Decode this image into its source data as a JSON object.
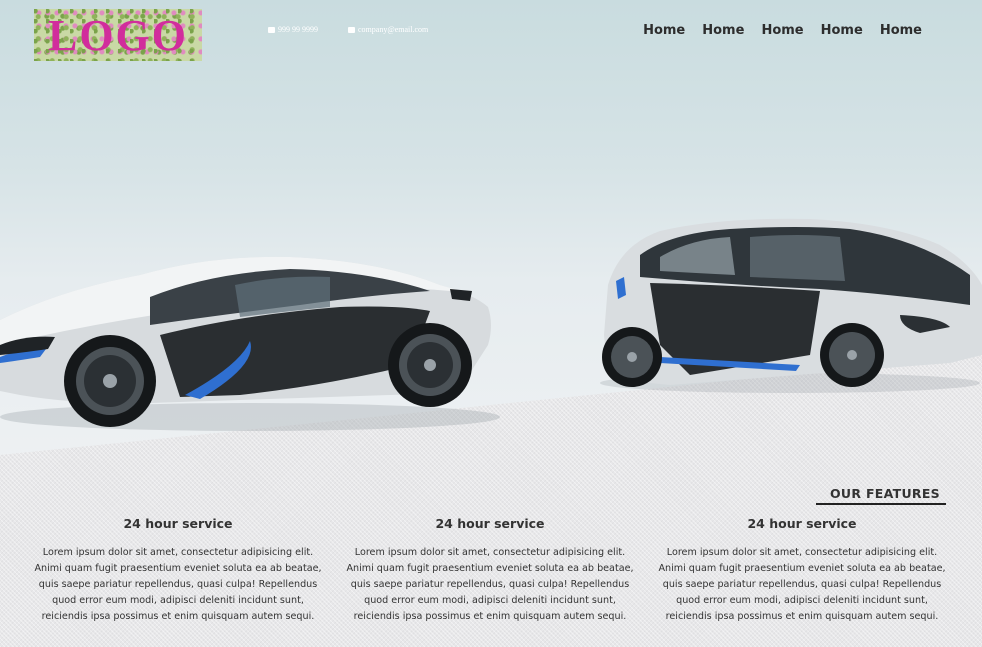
{
  "header": {
    "logo_text": "LOGO",
    "phone": "999 99 9999",
    "email": "company@email.com",
    "nav": [
      "Home",
      "Home",
      "Home",
      "Home",
      "Home"
    ]
  },
  "features": {
    "title": "OUR FEATURES",
    "items": [
      {
        "heading": "24 hour service",
        "text": "Lorem ipsum dolor sit amet, consectetur adipisicing elit. Animi quam fugit praesentium eveniet soluta ea ab beatae, quis saepe pariatur repellendus, quasi culpa! Repellendus quod error eum modi, adipisci deleniti incidunt sunt, reiciendis ipsa possimus et enim quisquam autem sequi."
      },
      {
        "heading": "24 hour service",
        "text": "Lorem ipsum dolor sit amet, consectetur adipisicing elit. Animi quam fugit praesentium eveniet soluta ea ab beatae, quis saepe pariatur repellendus, quasi culpa! Repellendus quod error eum modi, adipisci deleniti incidunt sunt, reiciendis ipsa possimus et enim quisquam autem sequi."
      },
      {
        "heading": "24 hour service",
        "text": "Lorem ipsum dolor sit amet, consectetur adipisicing elit. Animi quam fugit praesentium eveniet soluta ea ab beatae, quis saepe pariatur repellendus, quasi culpa! Repellendus quod error eum modi, adipisci deleniti incidunt sunt, reiciendis ipsa possimus et enim quisquam autem sequi."
      }
    ]
  },
  "colors": {
    "logo_text": "#d12d9c",
    "nav_text": "#2d2d2d",
    "car_accent": "#2f6fd0"
  },
  "icons": [
    "phone-icon",
    "mail-icon"
  ]
}
